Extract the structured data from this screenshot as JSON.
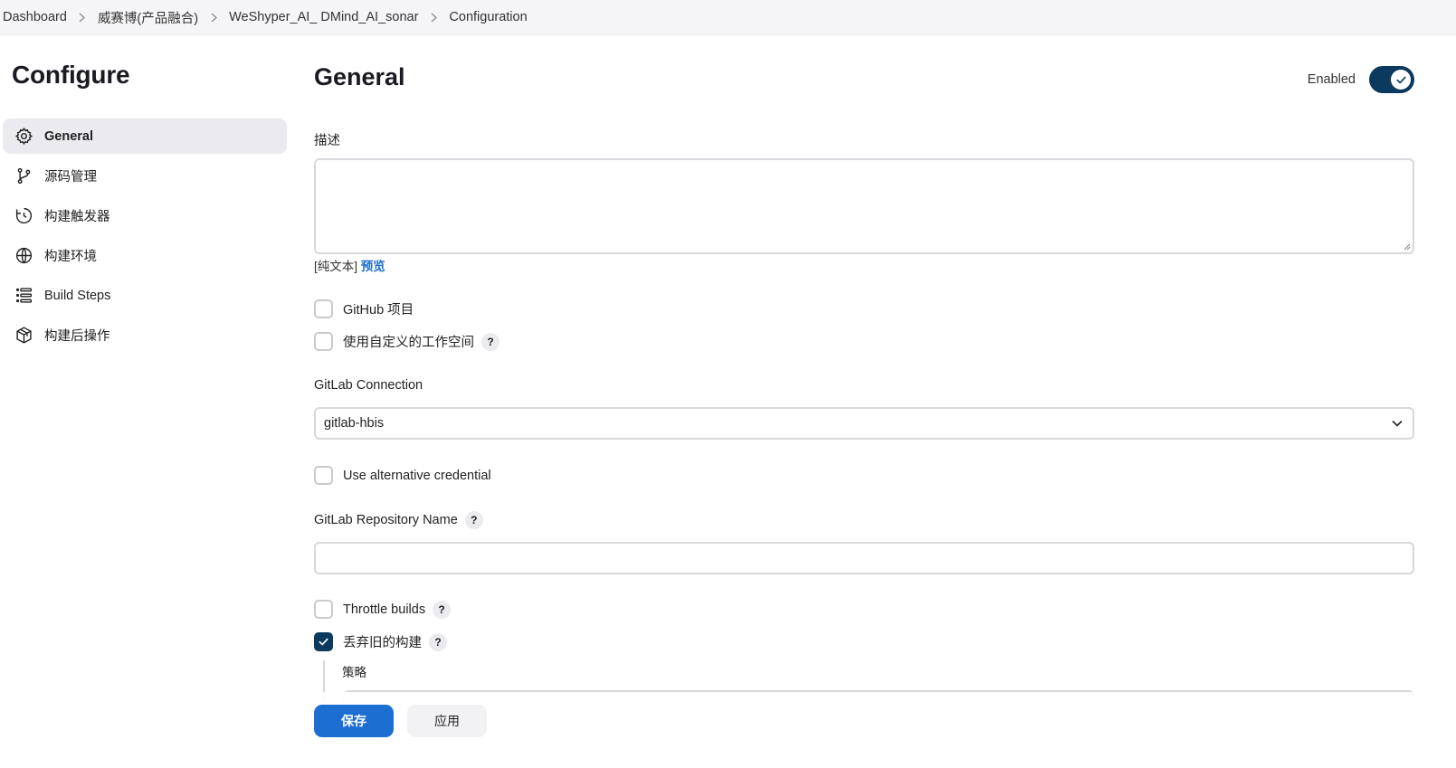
{
  "breadcrumb": [
    "Dashboard",
    "威赛博(产品融合)",
    "WeShyper_AI_ DMind_AI_sonar",
    "Configuration"
  ],
  "sidebar": {
    "title": "Configure",
    "items": [
      {
        "label": "General",
        "icon": "gear-icon",
        "active": true
      },
      {
        "label": "源码管理",
        "icon": "branch-icon",
        "active": false
      },
      {
        "label": "构建触发器",
        "icon": "clock-icon",
        "active": false
      },
      {
        "label": "构建环境",
        "icon": "globe-icon",
        "active": false
      },
      {
        "label": "Build Steps",
        "icon": "list-icon",
        "active": false
      },
      {
        "label": "构建后操作",
        "icon": "package-icon",
        "active": false
      }
    ]
  },
  "main": {
    "title": "General",
    "enabled_label": "Enabled",
    "enabled": true,
    "description_label": "描述",
    "description_value": "",
    "format_text": "[纯文本]",
    "preview_link": "预览",
    "github_project_label": "GitHub 项目",
    "custom_workspace_label": "使用自定义的工作空间",
    "gitlab_connection_label": "GitLab Connection",
    "gitlab_connection_value": "gitlab-hbis",
    "alt_credential_label": "Use alternative credential",
    "gitlab_repo_label": "GitLab Repository Name",
    "gitlab_repo_value": "",
    "throttle_label": "Throttle builds",
    "discard_old_label": "丢弃旧的构建",
    "discard_old_checked": true,
    "strategy_label": "策略",
    "help_symbol": "?"
  },
  "actions": {
    "save_label": "保存",
    "apply_label": "应用"
  },
  "colors": {
    "primary": "#1c6ed0",
    "toggle": "#0b3a5e",
    "active_bg": "#ebebef"
  }
}
